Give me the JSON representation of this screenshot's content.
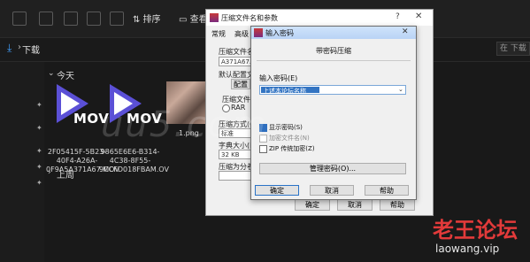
{
  "explorer": {
    "toolbar": {
      "sort_label": "⇅ 排序",
      "view_label": "▭ 查看"
    },
    "address": {
      "folder": "下载",
      "search_placeholder": "在 下载"
    },
    "groups": {
      "today": "今天",
      "last_week": "上周"
    },
    "files": [
      {
        "name": "2F05415F-5B23-40F4-A26A-0F9A5A371A67.MOV",
        "badge": "MOV"
      },
      {
        "name": "9865E6E6-B314-4C38-8F55-9CCFD018FBAM.OV",
        "badge": "MOV"
      },
      {
        "name": "1.png"
      }
    ]
  },
  "dialog": {
    "title": "压缩文件名和参数",
    "help": "?",
    "close": "✕",
    "tabs": [
      "常规",
      "高级"
    ],
    "archive_name_label": "压缩文件名",
    "archive_name_value": "A371A67.zi",
    "default_profile_label": "默认配置文",
    "profile_btn": "配置",
    "format_label": "压缩文件格",
    "format_rar": "RAR",
    "method_label": "压缩方式(C",
    "method_value": "标准",
    "dict_label": "字典大小(I",
    "dict_value": "32 KB",
    "split_label": "压缩为分卷",
    "ok": "确定",
    "cancel": "取消",
    "help_btn": "帮助"
  },
  "password_dialog": {
    "title": "输入密码",
    "close": "✕",
    "heading": "带密码压缩",
    "input_label": "输入密码(E)",
    "input_value": "上述本论坛名称",
    "options": [
      {
        "label": "显示密码(S)",
        "checked": true,
        "enabled": true
      },
      {
        "label": "加密文件名(N)",
        "checked": false,
        "enabled": false
      },
      {
        "label": "ZIP 传统加密(Z)",
        "checked": false,
        "enabled": true
      }
    ],
    "manage_btn": "管理密码(O)...",
    "ok": "确定",
    "cancel": "取消",
    "help": "帮助"
  },
  "watermark": {
    "overlay": "uu5.com",
    "site_cn": "老王论坛",
    "site_url": "laowang.vip"
  }
}
